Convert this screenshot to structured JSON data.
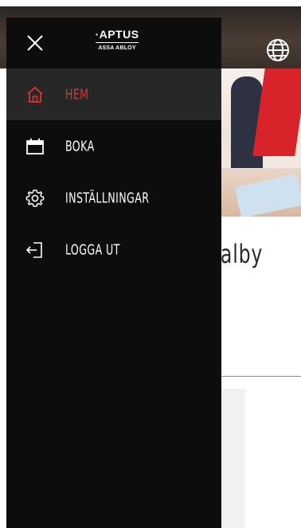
{
  "page": {
    "heading": "Valby"
  },
  "drawer": {
    "logo": {
      "main": "·APTUS",
      "sub": "ASSA ABLOY"
    },
    "menu": [
      {
        "label": "HEM",
        "icon": "home-icon",
        "active": true
      },
      {
        "label": "BOKA",
        "icon": "calendar-icon",
        "active": false
      },
      {
        "label": "INSTÄLLNINGAR",
        "icon": "gear-icon",
        "active": false
      },
      {
        "label": "LOGGA UT",
        "icon": "logout-icon",
        "active": false
      }
    ]
  },
  "colors": {
    "drawer_bg": "#0d0d0d",
    "active_bg": "#272727",
    "accent": "#d8323a",
    "text": "#ffffff"
  }
}
